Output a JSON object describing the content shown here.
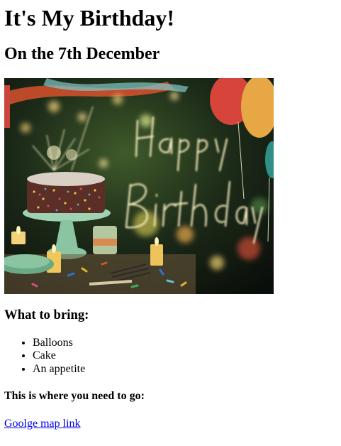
{
  "heading": "It's My Birthday!",
  "subheading": "On the 7th December",
  "image": {
    "sign_text": "Happy Birthday",
    "colors": {
      "background": "#1c2a18",
      "cake": "#d9cfc4",
      "stand": "#9ed2b2",
      "sparkle": "#fff6c8"
    }
  },
  "bring": {
    "title": "What to bring:",
    "items": [
      "Balloons",
      "Cake",
      "An appetite"
    ]
  },
  "where": {
    "title": "This is where you need to go:"
  },
  "link": {
    "label": "Goolge map link"
  }
}
